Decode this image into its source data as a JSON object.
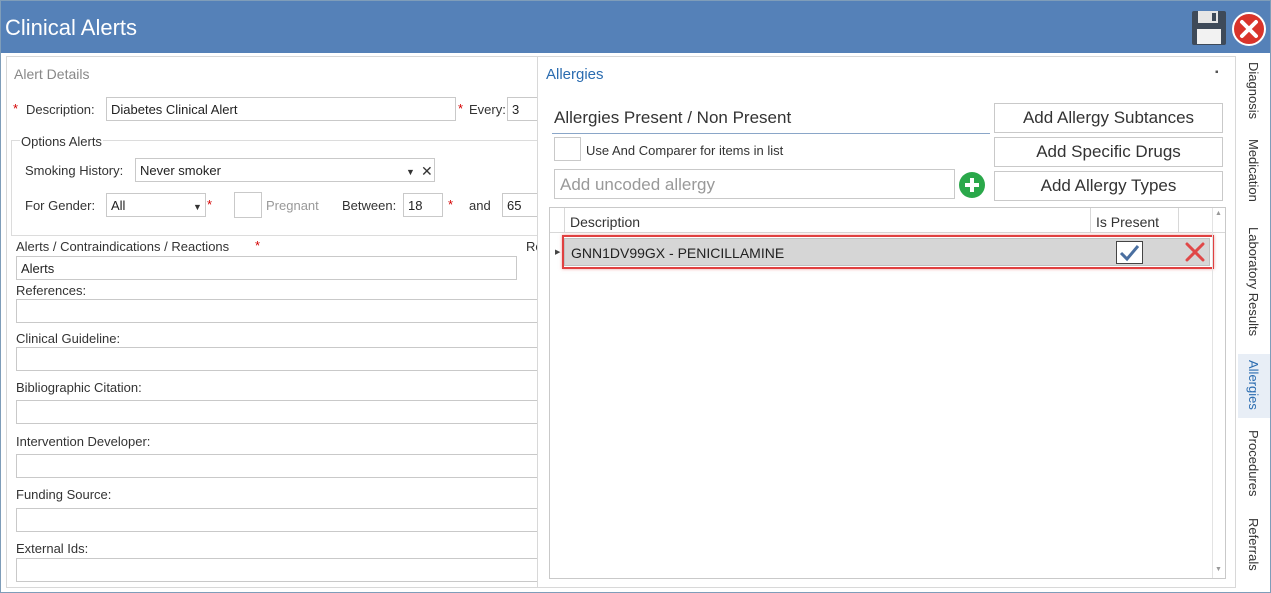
{
  "window": {
    "title": "Clinical Alerts"
  },
  "alert_details": {
    "section_title": "Alert Details",
    "required_mark": "*",
    "description_label": "Description:",
    "description_value": "Diabetes Clinical Alert",
    "every_label": "Every:",
    "every_value": "3",
    "options_title": "Options Alerts",
    "smoking_label": "Smoking History:",
    "smoking_value": "Never smoker",
    "gender_label": "For Gender:",
    "gender_value": "All",
    "pregnant_label": "Pregnant",
    "between_label": "Between:",
    "between_from": "18",
    "and_label": "and",
    "between_to": "65",
    "contra_label": "Alerts / Contraindications / Reactions",
    "contra_value": "Alerts",
    "clipped_label": "Re",
    "references_label": "References:",
    "guideline_label": "Clinical Guideline:",
    "citation_label": "Bibliographic Citation:",
    "developer_label": "Intervention Developer:",
    "funding_label": "Funding Source:",
    "external_label": "External Ids:"
  },
  "allergies": {
    "title": "Allergies",
    "present_label": "Allergies Present / Non Present",
    "comparer_label": "Use And Comparer for items in list",
    "uncoded_placeholder": "Add uncoded allergy",
    "buttons": {
      "add_substances": "Add Allergy Subtances",
      "add_drugs": "Add Specific Drugs",
      "add_types": "Add Allergy Types"
    },
    "grid": {
      "col_description": "Description",
      "col_is_present": "Is Present",
      "rows": [
        {
          "description": "GNN1DV99GX - PENICILLAMINE",
          "is_present": true
        }
      ]
    }
  },
  "side_tabs": [
    "Diagnosis",
    "Medication",
    "Laboratory Results",
    "Allergies",
    "Procedures",
    "Referrals"
  ],
  "colors": {
    "titlebar": "#5581b8",
    "accent": "#2b6cb0",
    "required": "#d40000",
    "highlight": "#e04040",
    "add_green": "#2aa84a"
  }
}
